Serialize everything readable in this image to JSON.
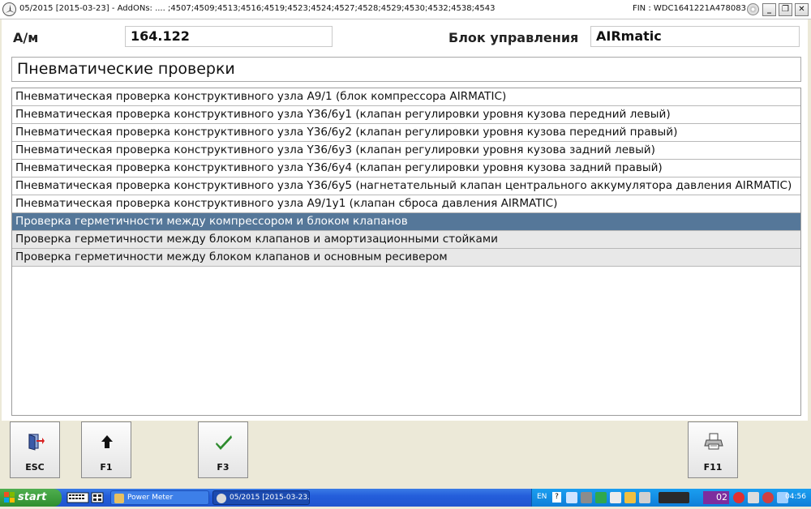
{
  "window": {
    "title": "05/2015 [2015-03-23] - AddONs:  .... ;4507;4509;4513;4516;4519;4523;4524;4527;4528;4529;4530;4532;4538;4543",
    "fin": "FIN : WDC1641221A478083",
    "min_label": "_",
    "restore_label": "❐",
    "close_label": "✕"
  },
  "header": {
    "vehicle_label": "А/м",
    "vehicle_value": "164.122",
    "control_unit_label": "Блок управления",
    "control_unit_value": "AIRmatic"
  },
  "section_title": "Пневматические проверки",
  "list": {
    "items": [
      "Пневматическая проверка конструктивного узла A9/1 (блок компрессора AIRMATIC)",
      "Пневматическая проверка конструктивного узла Y36/6y1 (клапан регулировки уровня кузова передний левый)",
      "Пневматическая проверка конструктивного узла Y36/6y2 (клапан регулировки уровня кузова передний правый)",
      "Пневматическая проверка конструктивного узла Y36/6y3 (клапан регулировки уровня кузова задний левый)",
      "Пневматическая проверка конструктивного узла Y36/6y4 (клапан регулировки уровня кузова задний правый)",
      "Пневматическая проверка конструктивного узла Y36/6y5 (нагнетательный клапан центрального аккумулятора давления AIRMATIC)",
      "Пневматическая проверка конструктивного узла A9/1y1 (клапан сброса давления AIRMATIC)",
      "Проверка герметичности между компрессором и блоком клапанов",
      "Проверка герметичности между блоком клапанов и амортизационными стойками",
      "Проверка герметичности между блоком клапанов и основным ресивером"
    ],
    "selected_index": 7
  },
  "buttons": {
    "esc": "ESC",
    "f1": "F1",
    "f3": "F3",
    "f11": "F11"
  },
  "taskbar": {
    "start": "start",
    "task1": "Power Meter",
    "task2": "05/2015 [2015-03-23...",
    "lang": "EN",
    "help": "?",
    "badge": "02",
    "clock": "04:56"
  },
  "colors": {
    "selected_row": "#557799",
    "taskbar": "#245edb",
    "start_button": "#3c9c3c",
    "check_icon": "#2e8b2e"
  }
}
